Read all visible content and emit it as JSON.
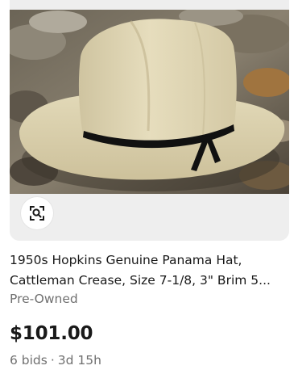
{
  "listing": {
    "title": "1950s Hopkins Genuine Panama Hat, Cattleman Crease, Size 7-1/8, 3\" Brim 5...",
    "condition": "Pre-Owned",
    "price": "$101.00",
    "bids": "6 bids",
    "separator": "·",
    "time_left": "3d 15h",
    "image_icon": "visual-search-icon"
  },
  "colors": {
    "text_primary": "#191919",
    "text_secondary": "#707070",
    "image_bg": "#eeeeee"
  }
}
